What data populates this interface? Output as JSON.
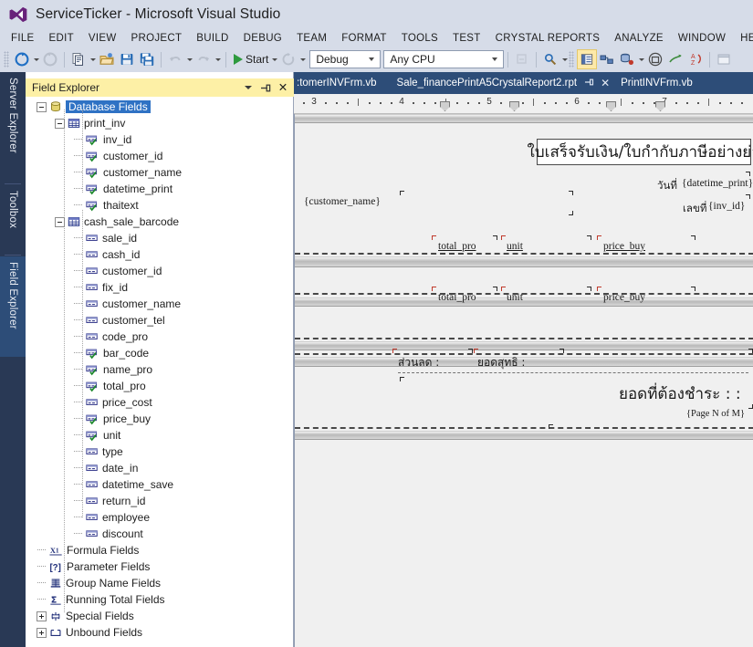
{
  "window": {
    "title": "ServiceTicker - Microsoft Visual Studio",
    "logo_icon": "visual-studio-logo-icon"
  },
  "menu": {
    "items": [
      {
        "label": "FILE"
      },
      {
        "label": "EDIT"
      },
      {
        "label": "VIEW"
      },
      {
        "label": "PROJECT"
      },
      {
        "label": "BUILD"
      },
      {
        "label": "DEBUG"
      },
      {
        "label": "TEAM"
      },
      {
        "label": "FORMAT"
      },
      {
        "label": "TOOLS"
      },
      {
        "label": "TEST"
      },
      {
        "label": "CRYSTAL REPORTS"
      },
      {
        "label": "ANALYZE"
      },
      {
        "label": "WINDOW"
      },
      {
        "label": "HEL"
      }
    ]
  },
  "toolbar": {
    "navigate_back_icon": "navigate-back-icon",
    "navigate_forward_icon": "navigate-forward-icon",
    "new_item_icon": "new-item-icon",
    "open_file_icon": "open-folder-icon",
    "save_icon": "save-icon",
    "save_all_icon": "save-all-icon",
    "undo_icon": "undo-icon",
    "redo_icon": "redo-icon",
    "start_label": "Start",
    "start_icon": "play-icon",
    "restart_icon": "restart-icon",
    "configuration": "Debug",
    "platform": "Any CPU",
    "step_icon": "step-into-icon",
    "find_icon": "find-in-files-icon",
    "properties_window_icon": "properties-window-icon",
    "solution_explorer_icon": "solution-explorer-icon",
    "object_browser_icon": "object-browser-icon",
    "toolbox_icon": "toolbox-icon",
    "error_list_icon": "error-list-icon",
    "sort_az_icon": "sort-az-icon",
    "dock_icon": "dock-window-icon"
  },
  "dock_tabs": [
    {
      "label": "Server Explorer",
      "active": false
    },
    {
      "label": "Toolbox",
      "active": false
    },
    {
      "label": "Field Explorer",
      "active": true
    }
  ],
  "field_explorer": {
    "title": "Field Explorer",
    "header_buttons": [
      {
        "name": "dropdown-menu-button",
        "glyph": "▾"
      },
      {
        "name": "pin-button",
        "glyph": "⊐"
      },
      {
        "name": "close-button",
        "glyph": "✕"
      }
    ],
    "tree": [
      {
        "label": "Database Fields",
        "level": 0,
        "expander": "minus",
        "icon": "database-icon",
        "selected": true
      },
      {
        "label": "print_inv",
        "level": 1,
        "expander": "minus",
        "icon": "table-icon",
        "selected": false
      },
      {
        "label": "inv_id",
        "level": 2,
        "expander": "none",
        "icon": "field-used-icon",
        "selected": false
      },
      {
        "label": "customer_id",
        "level": 2,
        "expander": "none",
        "icon": "field-used-icon",
        "selected": false
      },
      {
        "label": "customer_name",
        "level": 2,
        "expander": "none",
        "icon": "field-used-icon",
        "selected": false
      },
      {
        "label": "datetime_print",
        "level": 2,
        "expander": "none",
        "icon": "field-used-icon",
        "selected": false
      },
      {
        "label": "thaitext",
        "level": 2,
        "expander": "none",
        "icon": "field-used-icon",
        "selected": false
      },
      {
        "label": "cash_sale_barcode",
        "level": 1,
        "expander": "minus",
        "icon": "table-icon",
        "selected": false
      },
      {
        "label": "sale_id",
        "level": 2,
        "expander": "none",
        "icon": "field-icon",
        "selected": false
      },
      {
        "label": "cash_id",
        "level": 2,
        "expander": "none",
        "icon": "field-icon",
        "selected": false
      },
      {
        "label": "customer_id",
        "level": 2,
        "expander": "none",
        "icon": "field-icon",
        "selected": false
      },
      {
        "label": "fix_id",
        "level": 2,
        "expander": "none",
        "icon": "field-icon",
        "selected": false
      },
      {
        "label": "customer_name",
        "level": 2,
        "expander": "none",
        "icon": "field-icon",
        "selected": false
      },
      {
        "label": "customer_tel",
        "level": 2,
        "expander": "none",
        "icon": "field-icon",
        "selected": false
      },
      {
        "label": "code_pro",
        "level": 2,
        "expander": "none",
        "icon": "field-icon",
        "selected": false
      },
      {
        "label": "bar_code",
        "level": 2,
        "expander": "none",
        "icon": "field-used-icon",
        "selected": false
      },
      {
        "label": "name_pro",
        "level": 2,
        "expander": "none",
        "icon": "field-used-icon",
        "selected": false
      },
      {
        "label": "total_pro",
        "level": 2,
        "expander": "none",
        "icon": "field-used-icon",
        "selected": false
      },
      {
        "label": "price_cost",
        "level": 2,
        "expander": "none",
        "icon": "field-icon",
        "selected": false
      },
      {
        "label": "price_buy",
        "level": 2,
        "expander": "none",
        "icon": "field-used-icon",
        "selected": false
      },
      {
        "label": "unit",
        "level": 2,
        "expander": "none",
        "icon": "field-used-icon",
        "selected": false
      },
      {
        "label": "type",
        "level": 2,
        "expander": "none",
        "icon": "field-icon",
        "selected": false
      },
      {
        "label": "date_in",
        "level": 2,
        "expander": "none",
        "icon": "field-icon",
        "selected": false
      },
      {
        "label": "datetime_save",
        "level": 2,
        "expander": "none",
        "icon": "field-icon",
        "selected": false
      },
      {
        "label": "return_id",
        "level": 2,
        "expander": "none",
        "icon": "field-icon",
        "selected": false
      },
      {
        "label": "employee",
        "level": 2,
        "expander": "none",
        "icon": "field-icon",
        "selected": false
      },
      {
        "label": "discount",
        "level": 2,
        "expander": "none",
        "icon": "field-icon",
        "selected": false
      },
      {
        "label": "Formula Fields",
        "level": 0,
        "expander": "none",
        "icon": "formula-icon",
        "selected": false
      },
      {
        "label": "Parameter Fields",
        "level": 0,
        "expander": "none",
        "icon": "parameter-icon",
        "selected": false
      },
      {
        "label": "Group Name Fields",
        "level": 0,
        "expander": "none",
        "icon": "group-name-icon",
        "selected": false
      },
      {
        "label": "Running Total Fields",
        "level": 0,
        "expander": "none",
        "icon": "running-total-icon",
        "selected": false
      },
      {
        "label": "Special Fields",
        "level": 0,
        "expander": "plus",
        "icon": "special-fields-icon",
        "selected": false
      },
      {
        "label": "Unbound Fields",
        "level": 0,
        "expander": "plus",
        "icon": "unbound-fields-icon",
        "selected": false
      }
    ]
  },
  "document_tabs": [
    {
      "label": ":tomerINVFrm.vb",
      "active": false,
      "pin": false,
      "close": false
    },
    {
      "label": "Sale_financePrintA5CrystalReport2.rpt",
      "active": false,
      "pin": true,
      "close": true
    },
    {
      "label": "PrintINVFrm.vb",
      "active": false,
      "pin": false,
      "close": false
    }
  ],
  "ruler": {
    "numbers": [
      "3",
      "4",
      "5",
      "6",
      "7"
    ],
    "tab_stop_icon": "tab-stop-marker-icon"
  },
  "report": {
    "header_title": "ใบเสร็จรับเงิน/ใบกำกับภาษีอย่างย่อ",
    "date_label": "วันที่",
    "date_field": "{datetime_print}",
    "invoice_no_label": "เลขที่",
    "invoice_no_field": "{inv_id}",
    "customer_name_field": "{customer_name}",
    "detail_row_1": [
      {
        "text": "total_pro"
      },
      {
        "text": "unit"
      },
      {
        "text": "price_buy"
      }
    ],
    "detail_row_2": [
      {
        "text": "total_pro"
      },
      {
        "text": "unit"
      },
      {
        "text": "price_buy"
      }
    ],
    "discount_label": "ส่วนลด :",
    "net_total_label": "ยอดสุทธิ :",
    "amount_due_label": "ยอดที่ต้องชำระ : :",
    "page_field": "{Page N of M}"
  },
  "colors": {
    "titlebar": "#d6dce8",
    "dock_strip": "#293955",
    "doc_tab_strip": "#2d4d78",
    "panel_header": "#fdf0a6",
    "selection": "#2f72c4",
    "accent_green": "#2e9a3e"
  }
}
